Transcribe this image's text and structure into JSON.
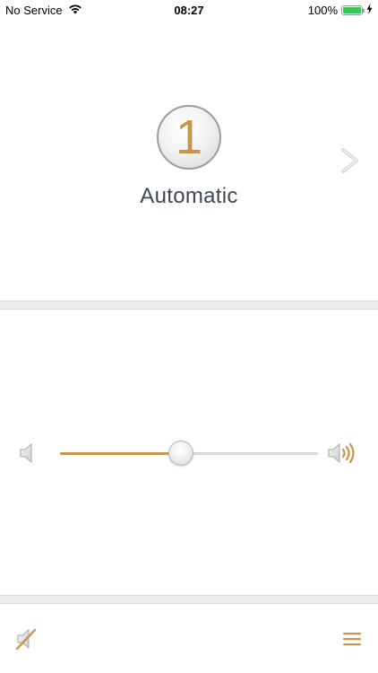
{
  "status_bar": {
    "carrier": "No Service",
    "time": "08:27",
    "battery_percent": "100%",
    "battery_level": 1.0
  },
  "program": {
    "number": "1",
    "name": "Automatic"
  },
  "volume": {
    "level": 0.47
  },
  "colors": {
    "accent": "#c8964b",
    "text": "#3e4753",
    "divider": "#ececec",
    "battery": "#34c759"
  },
  "icons": {
    "wifi": "wifi-icon",
    "charging": "bolt-icon",
    "next": "chevron-right-icon",
    "volume_low": "speaker-low-icon",
    "volume_high": "speaker-high-icon",
    "mute": "speaker-muted-icon",
    "menu": "hamburger-menu-icon"
  }
}
